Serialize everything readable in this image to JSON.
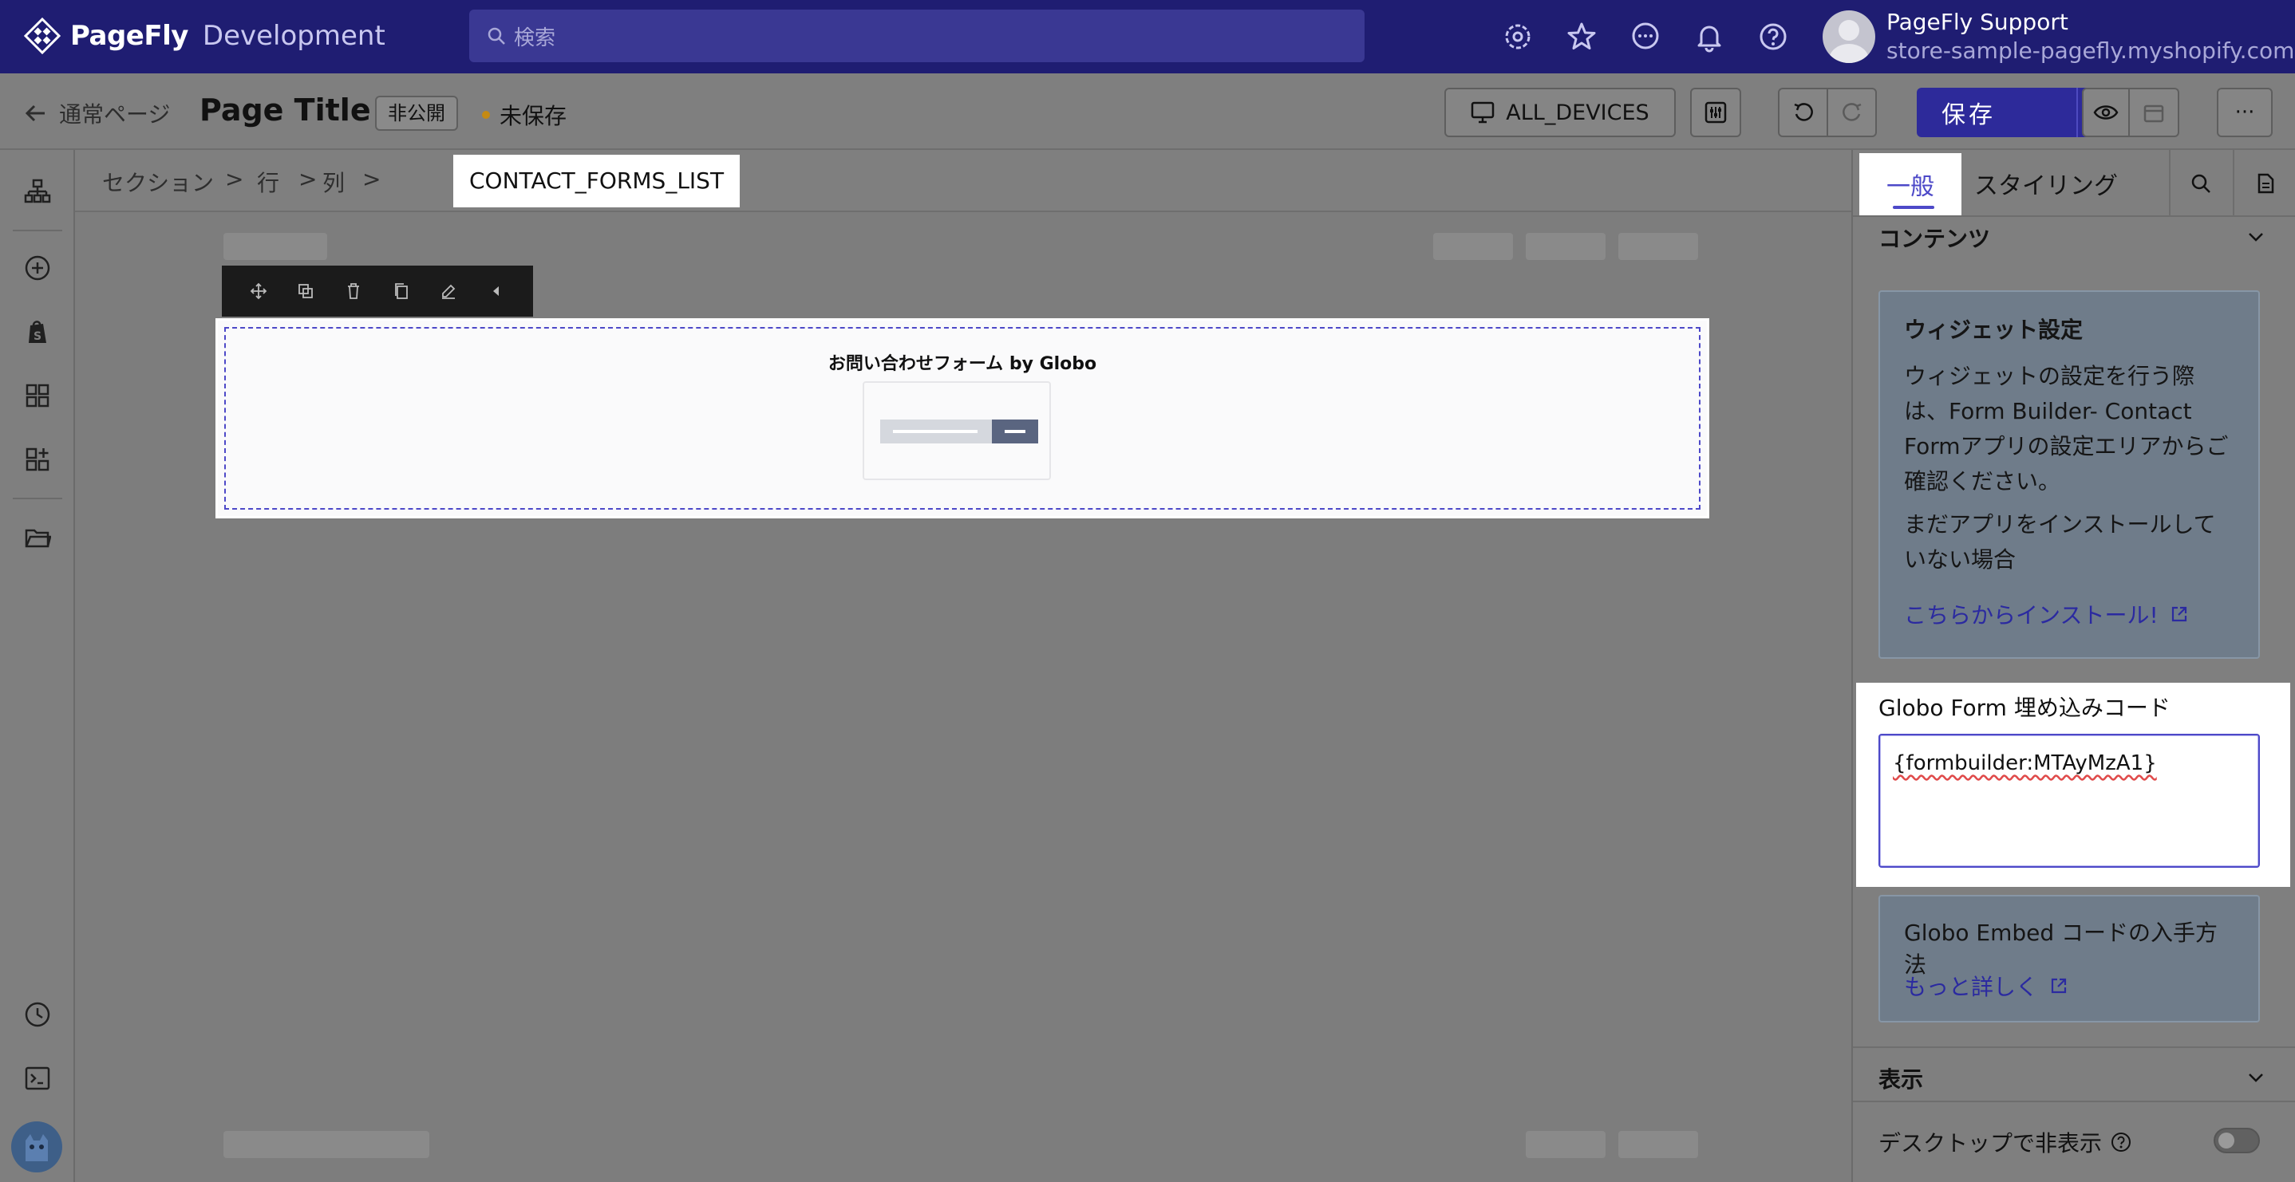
{
  "topbar": {
    "brand_name": "PageFly",
    "brand_sub": "Development",
    "search_placeholder": "検索",
    "icons": [
      "settings-icon",
      "star-icon",
      "chat-icon",
      "bell-icon",
      "help-icon"
    ],
    "user_name": "PageFly Support",
    "store_url": "store-sample-pagefly.myshopify.com"
  },
  "subbar": {
    "back_label": "通常ページ",
    "page_title": "Page Title",
    "status_badge": "非公開",
    "save_state": "未保存",
    "device_label": "ALL_DEVICES",
    "save_label": "保存",
    "more_label": "···",
    "save_state_color": "#c58a13"
  },
  "rail": {
    "icons": [
      "layers-icon",
      "add-icon",
      "shopify-icon",
      "grid-icon",
      "apps-icon",
      "folder-icon",
      "history-icon",
      "terminal-icon",
      "avatar-icon"
    ]
  },
  "breadcrumb": {
    "items": [
      "セクション",
      "行",
      "列"
    ],
    "separator": ">",
    "active": "CONTACT_FORMS_LIST"
  },
  "canvas": {
    "widget_title": "お問い合わせフォーム by Globo",
    "toolbar_icons": [
      "move-icon",
      "duplicate-icon",
      "delete-icon",
      "copy-icon",
      "style-icon",
      "collapse-icon"
    ]
  },
  "panel": {
    "tab_general": "一般",
    "tab_styling": "スタイリング",
    "section_contents": "コンテンツ",
    "info_title": "ウィジェット設定",
    "info_text_1": "ウィジェットの設定を行う際は、Form Builder- Contact Formアプリの設定エリアからご確認ください。",
    "info_text_2": "まだアプリをインストールしていない場合",
    "install_link": "こちらからインストール!",
    "embed_label": "Globo Form 埋め込みコード",
    "embed_value": "{formbuilder:MTAyMzA1}",
    "help_title": "Globo Embed コードの入手方法",
    "help_link": "もっと詳しく",
    "section_display": "表示",
    "hide_desktop_label": "デスクトップで非表示",
    "hide_desktop_on": false
  },
  "colors": {
    "topbar": "#1f1d72",
    "accent": "#4d49c8",
    "save_button": "#2d2a9a"
  }
}
